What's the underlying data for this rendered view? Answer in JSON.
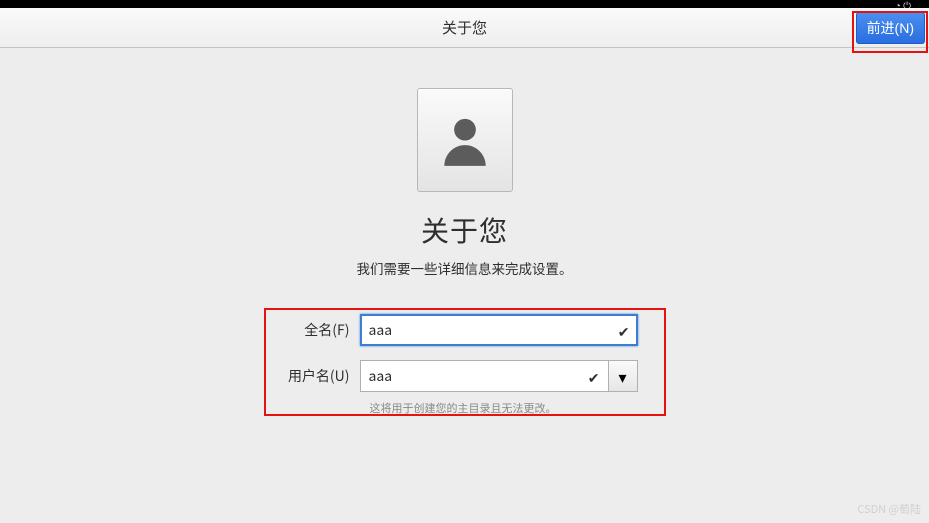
{
  "header": {
    "title": "关于您",
    "forward_label": "前进(N)"
  },
  "main": {
    "title": "关于您",
    "subtitle": "我们需要一些详细信息来完成设置。"
  },
  "form": {
    "full_name": {
      "label": "全名(F)",
      "value": "aaa"
    },
    "username": {
      "label": "用户名(U)",
      "value": "aaa",
      "hint": "这将用于创建您的主目录且无法更改。"
    }
  },
  "icons": {
    "check": "✔",
    "dropdown": "▾"
  },
  "watermark": "CSDN @萄陆"
}
